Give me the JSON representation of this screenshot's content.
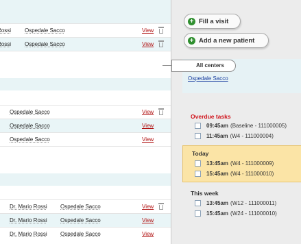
{
  "left": {
    "rows_top": [
      {
        "doctor": "Rossi",
        "center": "Ospedale Sacco",
        "view": "View",
        "trash": true
      },
      {
        "doctor": "Rossi",
        "center": "Ospedale Sacco",
        "view": "View",
        "trash": true
      }
    ],
    "rows_mid": [
      {
        "center": "Ospedale Sacco",
        "view": "View",
        "trash": true
      },
      {
        "center": "Ospedale Sacco",
        "view": "View",
        "trash": false
      },
      {
        "center": "Ospedale Sacco",
        "view": "View",
        "trash": false
      }
    ],
    "rows_bottom": [
      {
        "doctor": "Dr. Mario Rossi",
        "center": "Ospedale Sacco",
        "view": "View",
        "trash": true
      },
      {
        "doctor": "Dr. Mario Rossi",
        "center": "Ospedale Sacco",
        "view": "View",
        "trash": false
      },
      {
        "doctor": "Dr. Mario Rossi",
        "center": "Ospedale Sacco",
        "view": "View",
        "trash": false
      }
    ]
  },
  "buttons": {
    "fill_visit": "Fill a visit",
    "add_patient": "Add a new patient"
  },
  "centers": {
    "tab_label": "All centers",
    "link": "Ospedale Sacco"
  },
  "tasks": {
    "overdue": {
      "title": "Overdue tasks",
      "items": [
        {
          "time": "09:45am",
          "detail": "(Baseline - 111000005)"
        },
        {
          "time": "11:45am",
          "detail": "(W4 - 111000004)"
        }
      ]
    },
    "today": {
      "title": "Today",
      "items": [
        {
          "time": "13:45am",
          "detail": "(W4 - 111000009)"
        },
        {
          "time": "15:45am",
          "detail": "(W4 - 111000010)"
        }
      ]
    },
    "week": {
      "title": "This week",
      "items": [
        {
          "time": "13:45am",
          "detail": "(W12 - 111000011)"
        },
        {
          "time": "15:45am",
          "detail": "(W24 - 111000010)"
        }
      ]
    }
  },
  "colors": {
    "overdue_title": "#d0141c",
    "today_bg": "#fbe4a6",
    "row_alt": "#e9f5f7",
    "view_link": "#b01010",
    "center_link": "#1a3fa0",
    "plus_icon": "#2f8f2f"
  }
}
